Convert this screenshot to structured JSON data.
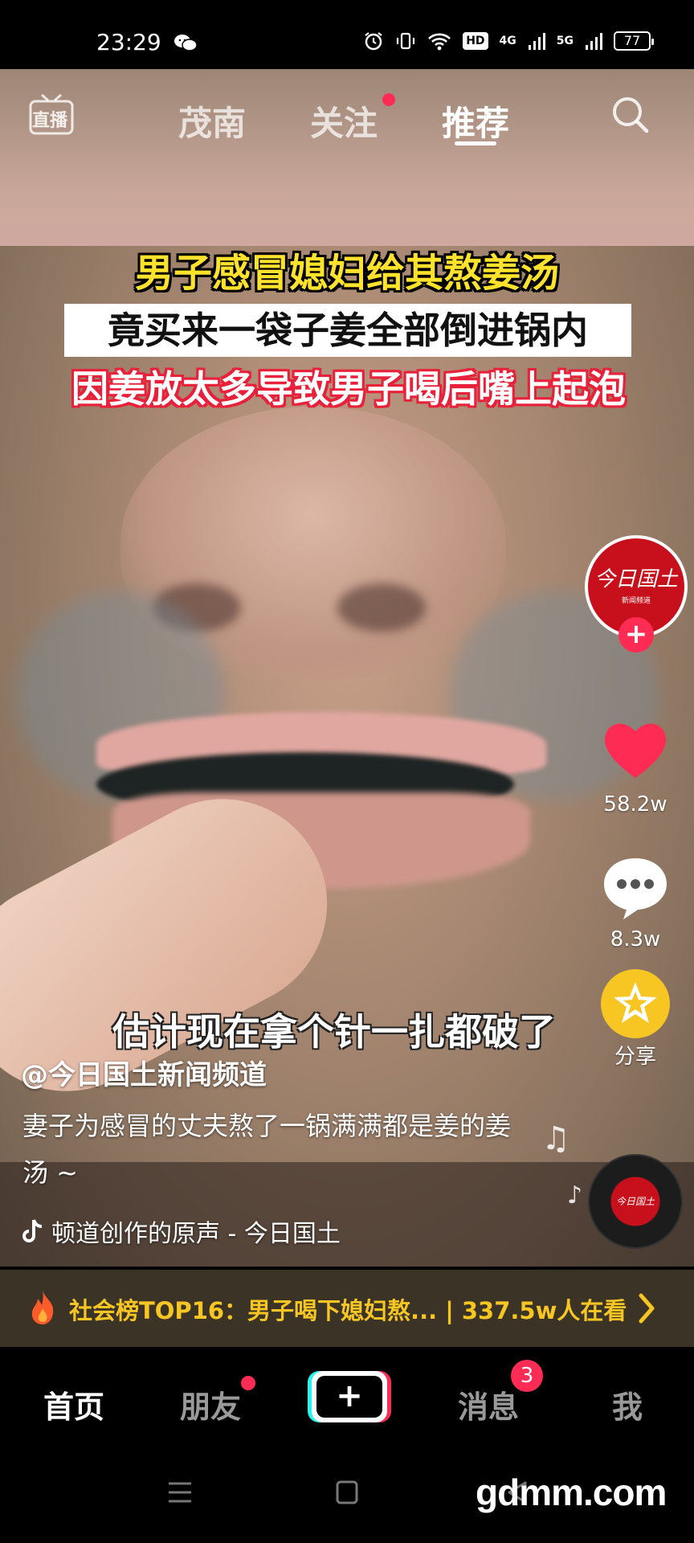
{
  "status_bar": {
    "time": "23:29",
    "hd_label": "HD",
    "net1": "4G",
    "net2": "5G",
    "battery": "77"
  },
  "top_nav": {
    "live_label": "直播",
    "tabs": [
      {
        "label": "茂南"
      },
      {
        "label": "关注"
      },
      {
        "label": "推荐"
      }
    ]
  },
  "video": {
    "caption_line1": "男子感冒媳妇给其熬姜汤",
    "caption_line2": "竟买来一袋子姜全部倒进锅内",
    "caption_line3": "因姜放太多导致男子喝后嘴上起泡",
    "subtitle": "估计现在拿个针一扎都破了"
  },
  "right_rail": {
    "avatar_text": "今日国土",
    "avatar_sub": "新闻频道",
    "like_count": "58.2w",
    "comment_count": "8.3w",
    "share_label": "分享",
    "disc_text": "今日国土"
  },
  "post": {
    "author": "@今日国土新闻频道",
    "description": "妻子为感冒的丈夫熬了一锅满满都是姜的姜汤 ~",
    "music": "顿道创作的原声 - 今日国土"
  },
  "hot_banner": {
    "text": "社会榜TOP16：男子喝下媳妇熬... | 337.5w人在看"
  },
  "tab_bar": {
    "home": "首页",
    "friends": "朋友",
    "create": "+",
    "messages": "消息",
    "messages_badge": "3",
    "me": "我"
  },
  "watermark": "gdmm.com",
  "colors": {
    "accent_red": "#fe2c55",
    "accent_cyan": "#25f4ee",
    "hot_yellow": "#f7c623"
  }
}
